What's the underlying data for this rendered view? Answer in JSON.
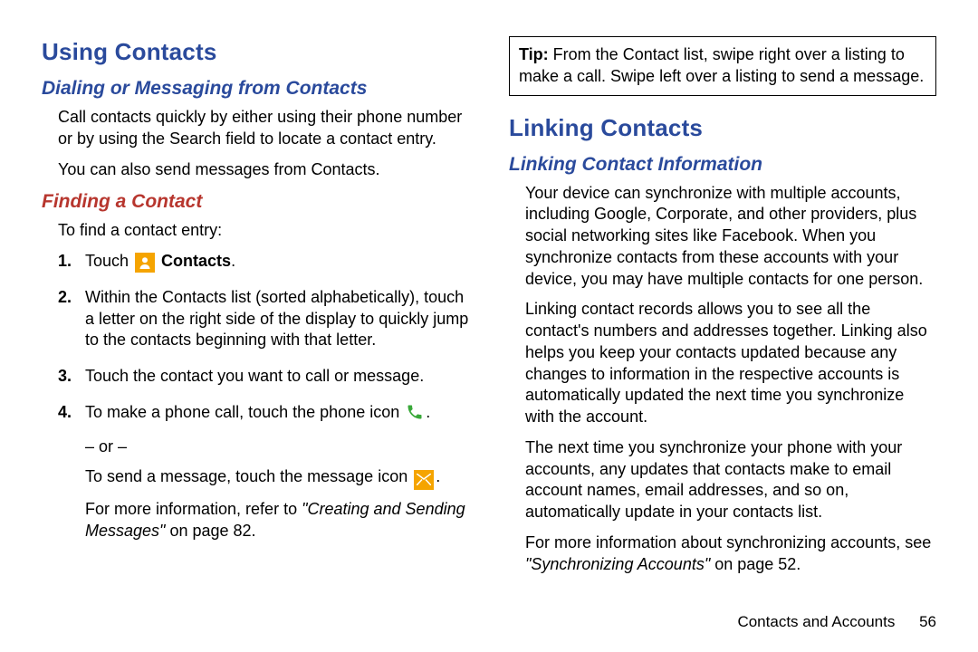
{
  "left": {
    "h1": "Using Contacts",
    "sub1": "Dialing or Messaging from Contacts",
    "p1": "Call contacts quickly by either using their phone number or by using the Search field to locate a contact entry.",
    "p2": "You can also send messages from Contacts.",
    "sub2": "Finding a Contact",
    "p3": "To find a contact entry:",
    "steps": {
      "s1a": "Touch ",
      "s1b": " Contacts",
      "s1c": ".",
      "s2": "Within the Contacts list (sorted alphabetically), touch a letter on the right side of the display to quickly jump to the contacts beginning with that letter.",
      "s3": "Touch the contact you want to call or message.",
      "s4a": "To make a phone call, touch the phone icon ",
      "s4b": ".",
      "s4or": "– or –",
      "s4c": "To send a message, touch the message icon ",
      "s4d": ".",
      "s4e1": "For more information, refer to ",
      "s4e2": "\"Creating and Sending Messages\"",
      "s4e3": " on page 82."
    }
  },
  "right": {
    "tipLabel": "Tip:",
    "tipBody": " From the Contact list, swipe right over a listing to make a call. Swipe left over a listing to send a message.",
    "h1": "Linking Contacts",
    "sub1": "Linking Contact Information",
    "p1": "Your device can synchronize with multiple accounts, including Google, Corporate, and other providers, plus social networking sites like Facebook. When you synchronize contacts from these accounts with your device, you may have multiple contacts for one person.",
    "p2": "Linking contact records allows you to see all the contact's numbers and addresses together. Linking also helps you keep your contacts updated because any changes to information in the respective accounts is automatically updated the next time you synchronize with the account.",
    "p3": "The next time you synchronize your phone with your accounts, any updates that contacts make to email account names, email addresses, and so on, automatically update in your contacts list.",
    "p4a": "For more information about synchronizing accounts, see ",
    "p4b": "\"Synchronizing Accounts\"",
    "p4c": " on page 52."
  },
  "footer": {
    "section": "Contacts and Accounts",
    "page": "56"
  },
  "chart_data": null
}
